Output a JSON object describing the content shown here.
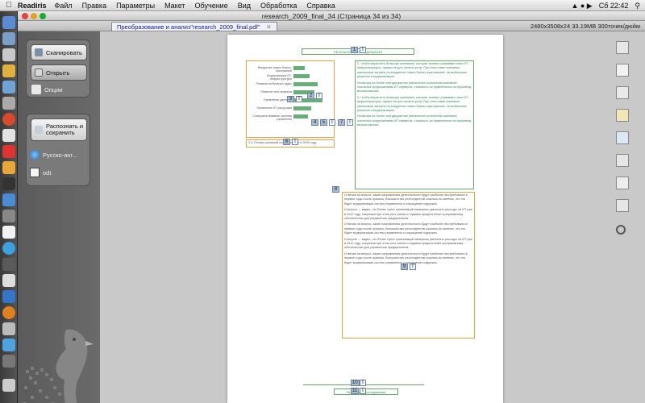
{
  "menubar": {
    "app": "Readiris",
    "items": [
      "Файл",
      "Правка",
      "Параметры",
      "Макет",
      "Обучение",
      "Вид",
      "Обработка",
      "Справка"
    ],
    "clock": "Сб 22:42"
  },
  "window": {
    "title": "research_2009_final_34 (Страница 34 из 34)",
    "doc_tab": "Преобразование и анализ\"research_2009_final.pdf\"",
    "doc_info": "2480x3508x24  33.19MB  300точек/дюйм"
  },
  "sidebar": {
    "scan_label": "Сканировать",
    "open_label": "Открыть",
    "options_label": "Опции",
    "recognize_label": "Распознать и сохранить",
    "language_label": "Русско-анг...",
    "format_label": "odt"
  },
  "page": {
    "header_text": "РЕЗУЛЬТАТЫ ИССЛЕДОВАНИЯ",
    "footer_text": "Результаты исследования",
    "page_num": "34",
    "zone_tags": [
      "1",
      "2",
      "3",
      "4",
      "5",
      "6",
      "7",
      "8",
      "9",
      "10",
      "11"
    ],
    "col_text_1": "2. Чтобы вырастить большую компанию, которые активно развивают свои ИТ-инфраструктуры, однако не для оплаты услуг. При этом такие компании уменьшили затраты на внедрение новых бизнес-приложений, на мобильные решения и модернизацию.",
    "col_text_2": "Несмотря на более чем двукратное увеличение количества компаний, лояльных предложениям ИТ-сервисов, стоимость их привлечения по-прежнему весьма высока.",
    "body_text_1": "Отвечая на вопрос, какие направления деятельности будут наиболее востребованы в первые годы после кризиса, большинство респондентов сошлись во мнении, что это будет модернизация систем управления и сокращение издержек.",
    "body_text_2": "И второе — видно, что более трети организаций намерены увеличить расходы на ИТ уже в 2010 году, опережая при этом рост рынка и отдавая предпочтение программному обеспечению для управления предприятием.",
    "figure_caption": "3.4. Планы компаний на ИТ-бюджет в 2009 году"
  },
  "colors": {
    "zone_border": "#f0a040",
    "zone_tag": "#aabbd0",
    "bar_green": "#66b077"
  }
}
